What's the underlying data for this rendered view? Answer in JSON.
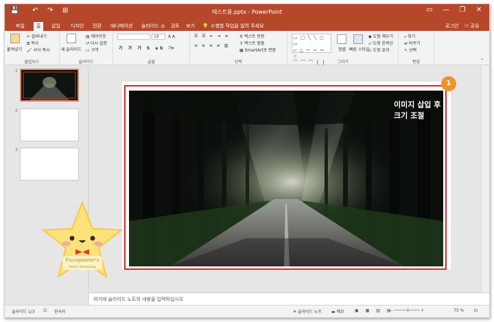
{
  "app": {
    "title": "테스트용.pptx - PowerPoint",
    "window_buttons": [
      "▭",
      "—",
      "❐",
      "✕"
    ],
    "quick_access": [
      "💾",
      "↶",
      "↷",
      "⊞"
    ]
  },
  "tabs": [
    {
      "label": "파일"
    },
    {
      "label": "홈"
    },
    {
      "label": "삽입"
    },
    {
      "label": "디자인"
    },
    {
      "label": "전환"
    },
    {
      "label": "애니메이션"
    },
    {
      "label": "슬라이드 쇼"
    },
    {
      "label": "검토"
    },
    {
      "label": "보기"
    }
  ],
  "tell_me": "수행할 작업을 알려 주세요",
  "account": {
    "login": "로그인",
    "share": "공유"
  },
  "ribbon": {
    "clipboard": {
      "paste": "붙여넣기",
      "cut": "잘라내기",
      "copy": "복사",
      "format_painter": "서식 복사",
      "label": "클립보드"
    },
    "slides": {
      "new_slide": "새 슬라이드",
      "layout": "레이아웃",
      "reset": "다시 설정",
      "section": "구역",
      "label": "슬라이드"
    },
    "font": {
      "size": "18",
      "label": "글꼴"
    },
    "paragraph": {
      "text_direction": "텍스트 방향",
      "align_text": "텍스트 맞춤",
      "smartart": "SmartArt로 변환",
      "label": "단락"
    },
    "drawing": {
      "arrange": "정렬",
      "quick_styles": "빠른 스타일",
      "shape_fill": "도형 채우기",
      "shape_outline": "도형 윤곽선",
      "shape_effects": "도형 효과",
      "label": "그리기"
    },
    "editing": {
      "find": "찾기",
      "replace": "바꾸기",
      "select": "선택",
      "label": "편집"
    }
  },
  "thumbnails": [
    {
      "number": "1"
    },
    {
      "number": "2"
    },
    {
      "number": "3"
    }
  ],
  "slide": {
    "callout_text": "이미지 삽입 후 크기 조절",
    "badge": "1"
  },
  "notes_placeholder": "여기에 슬라이드 노트의 내용을 입력하십시오",
  "status": {
    "slide_counter": "슬라이드 1/3",
    "language": "한국어",
    "notes_button": "슬라이드 노트",
    "comments_button": "메모",
    "zoom": "75 %"
  },
  "sticker": {
    "text_line1": "Pucogninter's",
    "text_line2": "Multi Workshop"
  },
  "colors": {
    "accent": "#b7472a",
    "highlight": "#d3262a",
    "badge": "#f0922b"
  }
}
